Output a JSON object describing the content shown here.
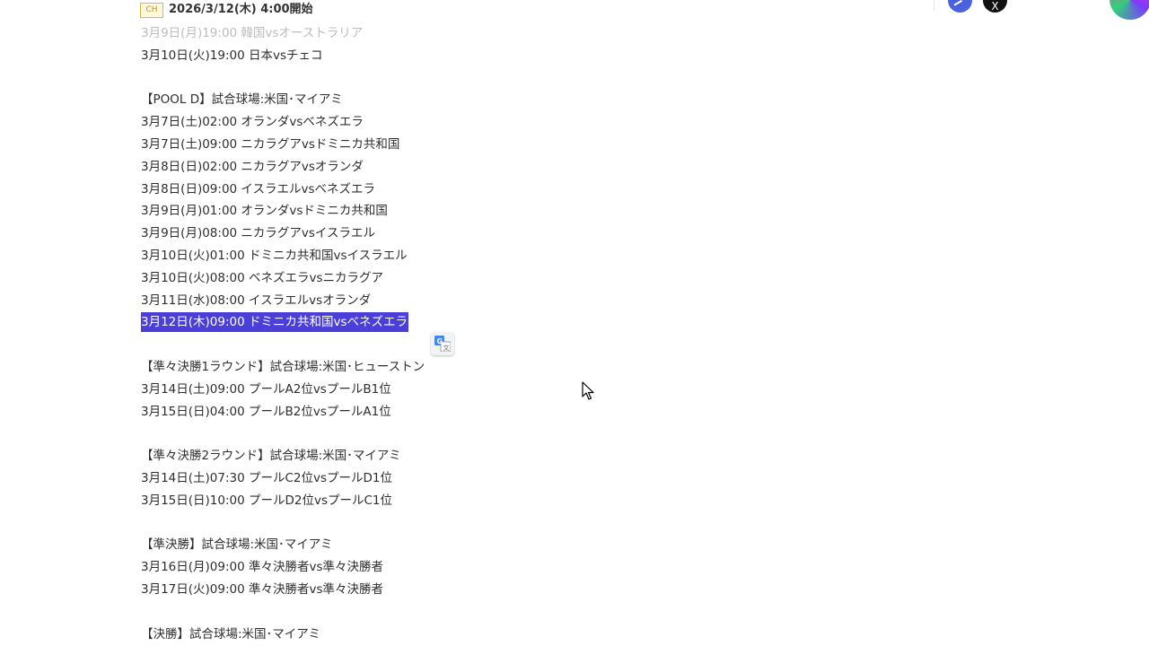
{
  "header": {
    "badge": "CH",
    "start_time": "2026/3/12(木) 4:00開始"
  },
  "share": {
    "x_label": "X"
  },
  "schedule_lines": [
    {
      "text": "3月9日(月)19:00 韓国vsオーストラリア",
      "type": "cut"
    },
    {
      "text": "3月10日(火)19:00 日本vsチェコ",
      "type": "normal"
    },
    {
      "text": "",
      "type": "blank"
    },
    {
      "text": "【POOL D】試合球場:米国･マイアミ",
      "type": "normal"
    },
    {
      "text": "3月7日(土)02:00 オランダvsベネズエラ",
      "type": "normal"
    },
    {
      "text": "3月7日(土)09:00 ニカラグアvsドミニカ共和国",
      "type": "normal"
    },
    {
      "text": "3月8日(日)02:00 ニカラグアvsオランダ",
      "type": "normal"
    },
    {
      "text": "3月8日(日)09:00 イスラエルvsベネズエラ",
      "type": "normal"
    },
    {
      "text": "3月9日(月)01:00 オランダvsドミニカ共和国",
      "type": "normal"
    },
    {
      "text": "3月9日(月)08:00 ニカラグアvsイスラエル",
      "type": "normal"
    },
    {
      "text": "3月10日(火)01:00 ドミニカ共和国vsイスラエル",
      "type": "normal"
    },
    {
      "text": "3月10日(火)08:00 ベネズエラvsニカラグア",
      "type": "normal"
    },
    {
      "text": "3月11日(水)08:00 イスラエルvsオランダ",
      "type": "normal"
    },
    {
      "text": "3月12日(木)09:00 ドミニカ共和国vsベネズエラ",
      "type": "selected"
    },
    {
      "text": "",
      "type": "blank"
    },
    {
      "text": "【準々決勝1ラウンド】試合球場:米国･ヒューストン",
      "type": "normal"
    },
    {
      "text": "3月14日(土)09:00 プールA2位vsプールB1位",
      "type": "normal"
    },
    {
      "text": "3月15日(日)04:00 プールB2位vsプールA1位",
      "type": "normal"
    },
    {
      "text": "",
      "type": "blank"
    },
    {
      "text": "【準々決勝2ラウンド】試合球場:米国･マイアミ",
      "type": "normal"
    },
    {
      "text": "3月14日(土)07:30 プールC2位vsプールD1位",
      "type": "normal"
    },
    {
      "text": "3月15日(日)10:00 プールD2位vsプールC1位",
      "type": "normal"
    },
    {
      "text": "",
      "type": "blank"
    },
    {
      "text": "【準決勝】試合球場:米国･マイアミ",
      "type": "normal"
    },
    {
      "text": "3月16日(月)09:00 準々決勝者vs準々決勝者",
      "type": "normal"
    },
    {
      "text": "3月17日(火)09:00 準々決勝者vs準々決勝者",
      "type": "normal"
    },
    {
      "text": "",
      "type": "blank"
    },
    {
      "text": "【決勝】試合球場:米国･マイアミ",
      "type": "normal"
    }
  ],
  "colors": {
    "selection": "#4a3fd8",
    "facebook": "#4b62e0"
  },
  "icons": [
    "translate-icon",
    "facebook-icon",
    "x-icon",
    "share-icon",
    "mouse-cursor-icon"
  ]
}
